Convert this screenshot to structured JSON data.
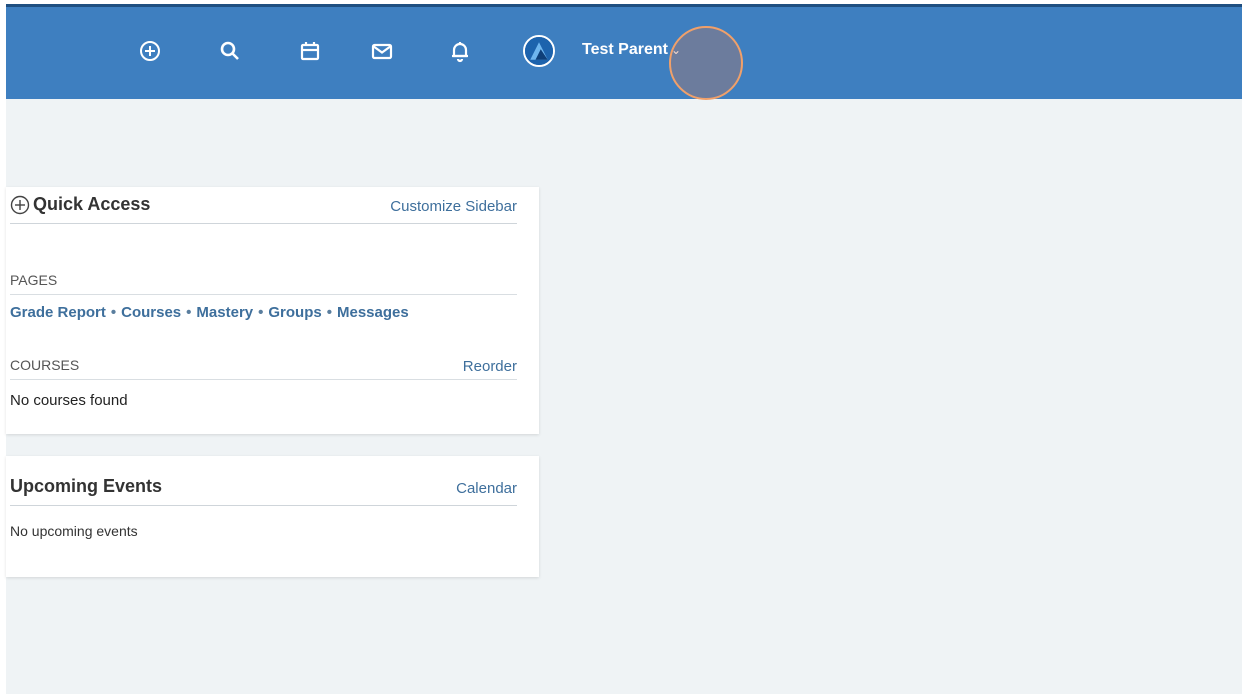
{
  "topbar": {
    "icons": [
      "plus-circle-icon",
      "search-icon",
      "calendar-icon",
      "mail-icon",
      "bell-icon"
    ],
    "user_name": "Test Parent",
    "user_chevron": "⌄"
  },
  "colors": {
    "topbar": "#3e7fc0",
    "background": "#eff3f5",
    "link": "#3e6f9c"
  },
  "quick_access": {
    "title": "Quick Access",
    "customize_link": "Customize Sidebar",
    "pages_label": "PAGES",
    "pages": [
      "Grade Report",
      "Courses",
      "Mastery",
      "Groups",
      "Messages"
    ],
    "separator": "•",
    "courses_label": "COURSES",
    "reorder_link": "Reorder",
    "courses_empty": "No courses found"
  },
  "upcoming_events": {
    "title": "Upcoming Events",
    "calendar_link": "Calendar",
    "empty": "No upcoming events"
  }
}
